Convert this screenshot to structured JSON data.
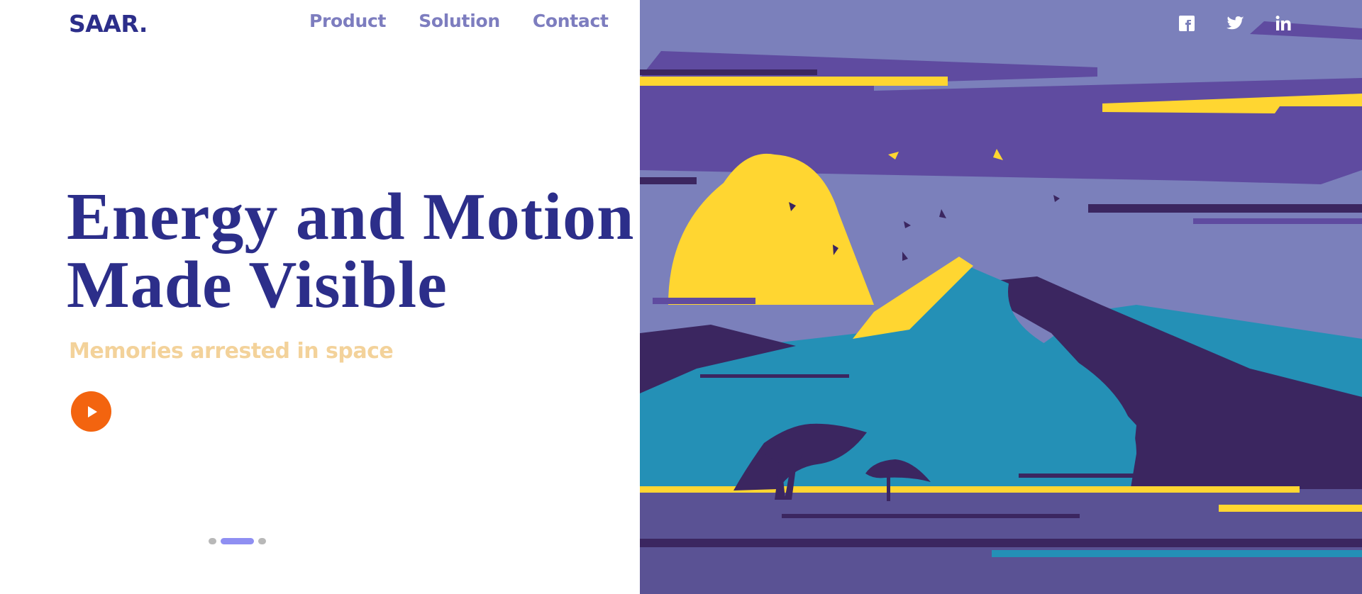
{
  "brand": {
    "logo_text": "SAAR."
  },
  "nav": {
    "items": [
      {
        "label": "Product"
      },
      {
        "label": "Solution"
      },
      {
        "label": "Contact"
      }
    ]
  },
  "hero": {
    "headline_line1": "Energy and Motion",
    "headline_line2": "Made Visible",
    "subtitle": "Memories arrested in space",
    "play_icon": "play-icon"
  },
  "carousel": {
    "count": 3,
    "active_index": 1
  },
  "social": {
    "icons": [
      "facebook-icon",
      "twitter-icon",
      "linkedin-icon"
    ]
  },
  "colors": {
    "brand": "#2c2e8a",
    "nav": "#7d7dbf",
    "subtitle": "#f3d29a",
    "accent": "#f3640f",
    "indicator_active": "#8f8ff2",
    "sky": "#7b80bb",
    "sun": "#ffd631",
    "mountain": "#2490b6",
    "dark_purple": "#3b2660"
  }
}
